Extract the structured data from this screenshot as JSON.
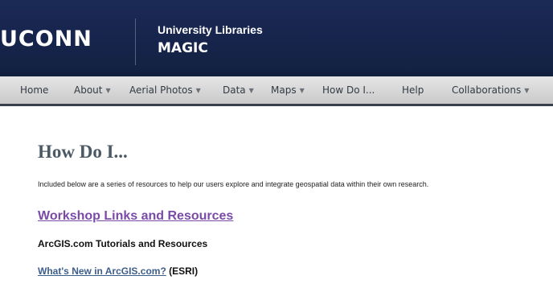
{
  "header": {
    "logo_text": "UCONN",
    "library_name": "University Libraries",
    "subtitle": "MAGIC"
  },
  "nav": {
    "items": [
      {
        "label": "Home",
        "has_dropdown": false
      },
      {
        "label": "About",
        "has_dropdown": true
      },
      {
        "label": "Aerial Photos",
        "has_dropdown": true
      },
      {
        "label": "Data",
        "has_dropdown": true
      },
      {
        "label": "Maps",
        "has_dropdown": true
      },
      {
        "label": "How Do I...",
        "has_dropdown": false
      },
      {
        "label": "Help",
        "has_dropdown": false
      },
      {
        "label": "Collaborations",
        "has_dropdown": true
      }
    ]
  },
  "content": {
    "title": "How Do I...",
    "intro": "Included below are a series of resources to help our users explore and integrate geospatial data within their own research.",
    "workshop_link": "Workshop Links and Resources",
    "tutorials_heading": "ArcGIS.com Tutorials and Resources",
    "whats_new_link": "What's New in ArcGIS.com?",
    "whats_new_suffix": " (ESRI)"
  },
  "colors": {
    "banner": "#16244b",
    "nav_background": "#d6d6d6",
    "link": "#3d5e8a",
    "visited_link": "#7a4aa8",
    "title": "#4b5966"
  }
}
